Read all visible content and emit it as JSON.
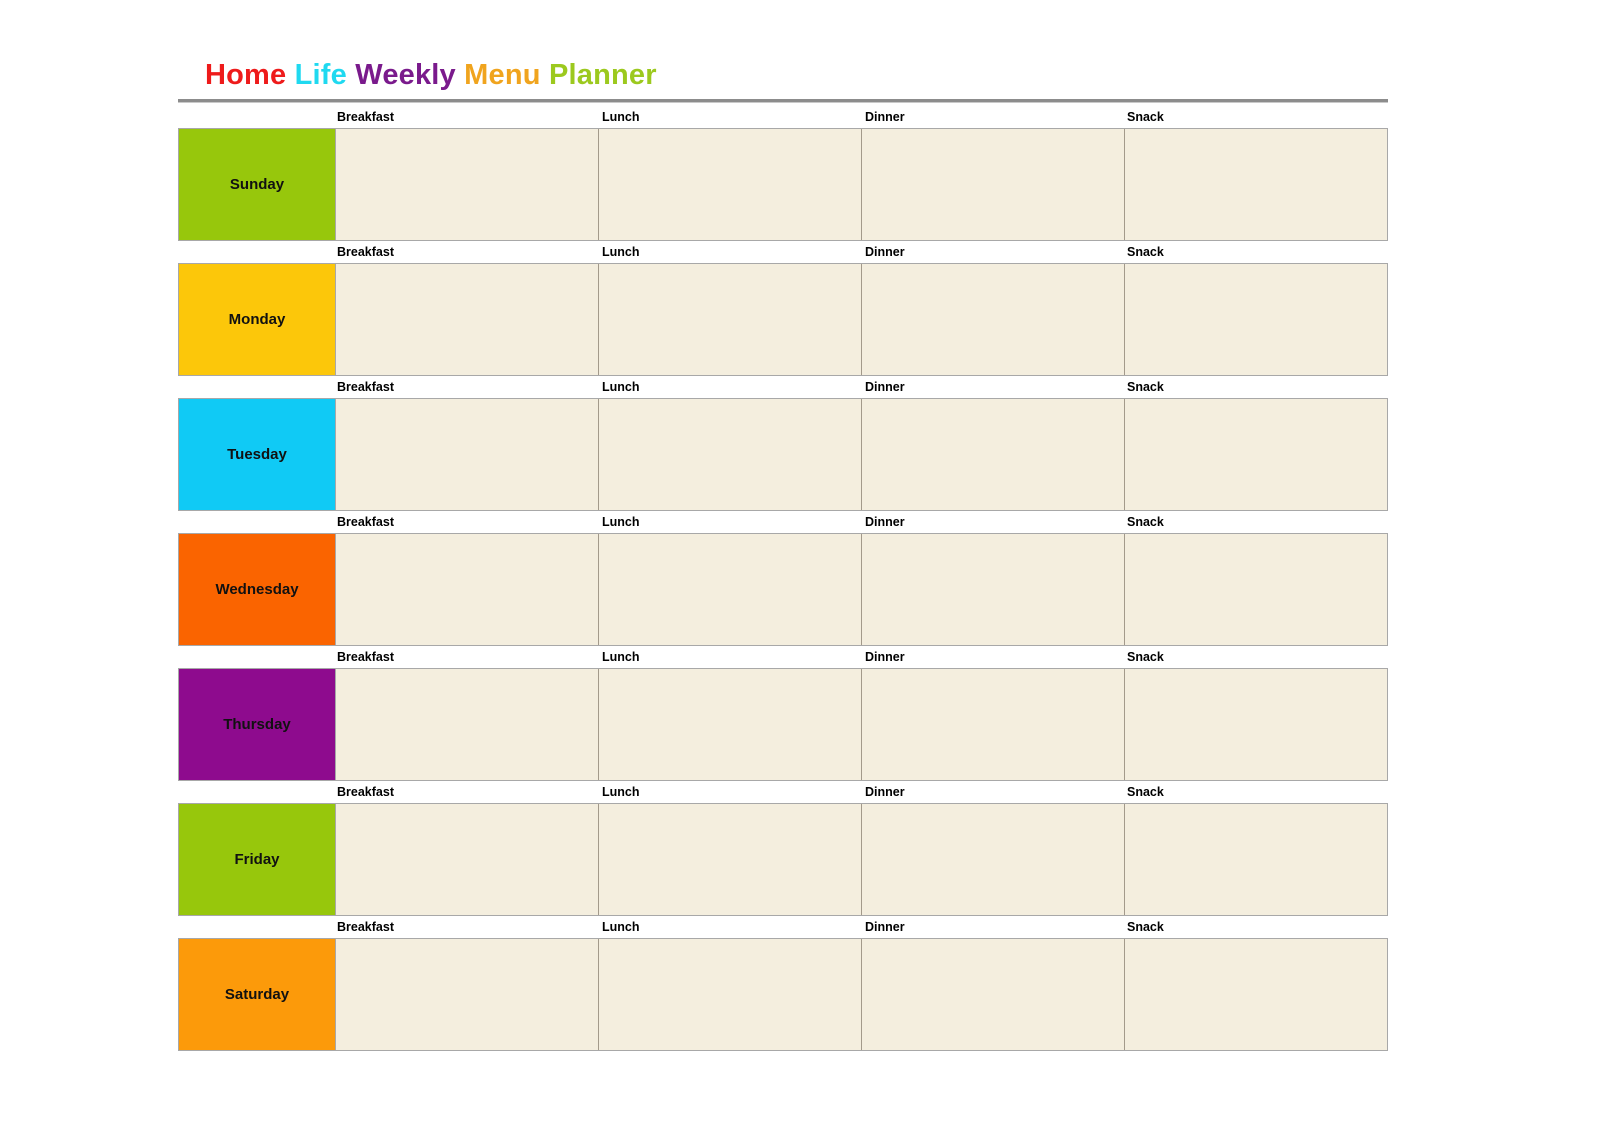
{
  "title": {
    "words": [
      {
        "text": "Home",
        "color": "#EE1B1B"
      },
      {
        "text": "Life",
        "color": "#1FD9F0"
      },
      {
        "text": "Weekly",
        "color": "#7A1A8C"
      },
      {
        "text": "Menu",
        "color": "#F0A41E"
      },
      {
        "text": "Planner",
        "color": "#9CC91E"
      }
    ],
    "full_text": "Home Life Weekly Menu Planner"
  },
  "columns": [
    "Breakfast",
    "Lunch",
    "Dinner",
    "Snack"
  ],
  "cell_fill_color": "#F4EEDE",
  "border_color": "#A8A8A8",
  "days": [
    {
      "label": "Sunday",
      "color": "#97C70C"
    },
    {
      "label": "Monday",
      "color": "#FCC70A"
    },
    {
      "label": "Tuesday",
      "color": "#10CAF5"
    },
    {
      "label": "Wednesday",
      "color": "#FA6400"
    },
    {
      "label": "Thursday",
      "color": "#8E0B8E"
    },
    {
      "label": "Friday",
      "color": "#97C70C"
    },
    {
      "label": "Saturday",
      "color": "#FC9A0A"
    }
  ]
}
